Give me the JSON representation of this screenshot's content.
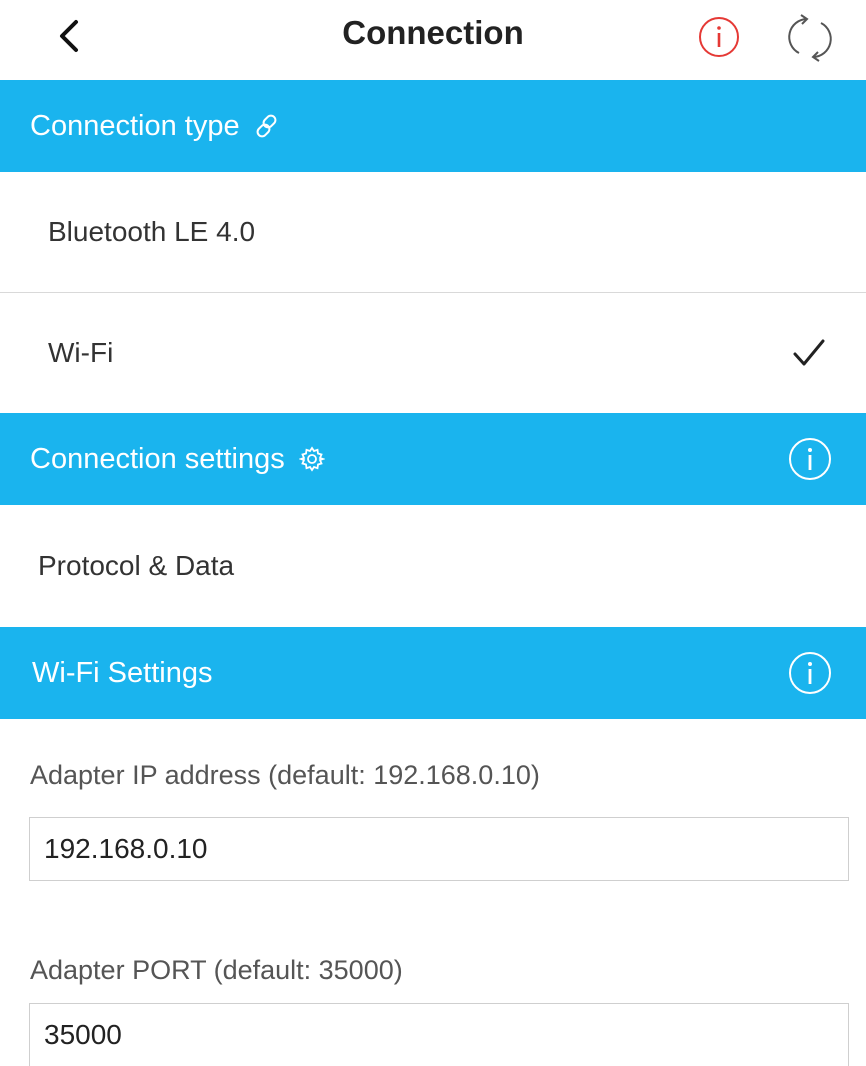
{
  "colors": {
    "accent": "#1ab4ee",
    "info_top": "#e53935",
    "text": "#333333"
  },
  "header": {
    "title": "Connection",
    "back_icon": "chevron-left-icon",
    "info_icon": "info-icon",
    "refresh_icon": "refresh-icon"
  },
  "connection_type": {
    "title": "Connection type",
    "icon": "link-icon",
    "options": [
      {
        "label": "Bluetooth LE 4.0",
        "selected": false
      },
      {
        "label": "Wi-Fi",
        "selected": true
      }
    ]
  },
  "connection_settings": {
    "title": "Connection settings",
    "icon": "gear-icon",
    "info_icon": "info-icon",
    "items": [
      {
        "label": "Protocol & Data"
      }
    ]
  },
  "wifi_settings": {
    "title": "Wi-Fi Settings",
    "info_icon": "info-icon",
    "ip_label": "Adapter IP address (default: 192.168.0.10)",
    "ip_value": "192.168.0.10",
    "port_label": "Adapter PORT (default: 35000)",
    "port_value": "35000"
  }
}
